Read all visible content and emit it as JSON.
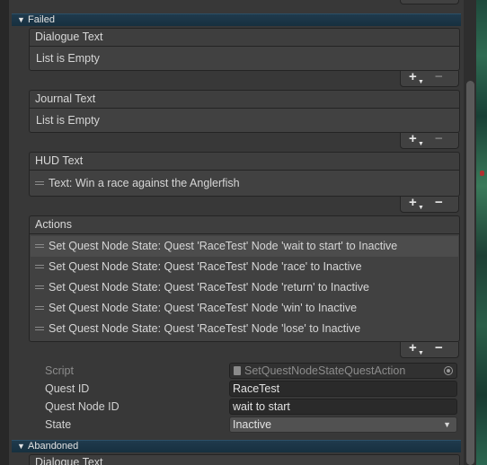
{
  "colors": {
    "background": "#383838",
    "foldout_header": "#17303f",
    "field_bg": "#2a2a2a",
    "text": "#d2d2d2"
  },
  "foldouts": {
    "failed": {
      "label": "Failed",
      "expanded": true
    },
    "abandoned": {
      "label": "Abandoned",
      "expanded": true
    }
  },
  "lists": {
    "dialogue": {
      "header": "Dialogue Text",
      "empty": "List is Empty"
    },
    "journal": {
      "header": "Journal Text",
      "empty": "List is Empty"
    },
    "hud": {
      "header": "HUD Text",
      "items": [
        "Text: Win a race against the Anglerfish"
      ]
    },
    "actions": {
      "header": "Actions",
      "items": [
        "Set Quest Node State: Quest 'RaceTest' Node 'wait to start' to Inactive",
        "Set Quest Node State: Quest 'RaceTest' Node 'race' to Inactive",
        "Set Quest Node State: Quest 'RaceTest' Node 'return' to Inactive",
        "Set Quest Node State: Quest 'RaceTest' Node 'win' to Inactive",
        "Set Quest Node State: Quest 'RaceTest' Node 'lose' to Inactive"
      ]
    }
  },
  "list_controls": {
    "add": "+",
    "remove": "−"
  },
  "action_props": {
    "script_label": "Script",
    "script_value": "SetQuestNodeStateQuestAction",
    "quest_id_label": "Quest ID",
    "quest_id_value": "RaceTest",
    "quest_node_id_label": "Quest Node ID",
    "quest_node_id_value": "wait to start",
    "state_label": "State",
    "state_value": "Inactive"
  },
  "abandoned_first": {
    "header": "Dialogue Text"
  },
  "icons": [
    "foldout-triangle-icon",
    "drag-handle-icon",
    "plus-icon",
    "minus-icon",
    "script-file-icon",
    "object-picker-icon",
    "dropdown-caret-icon"
  ]
}
